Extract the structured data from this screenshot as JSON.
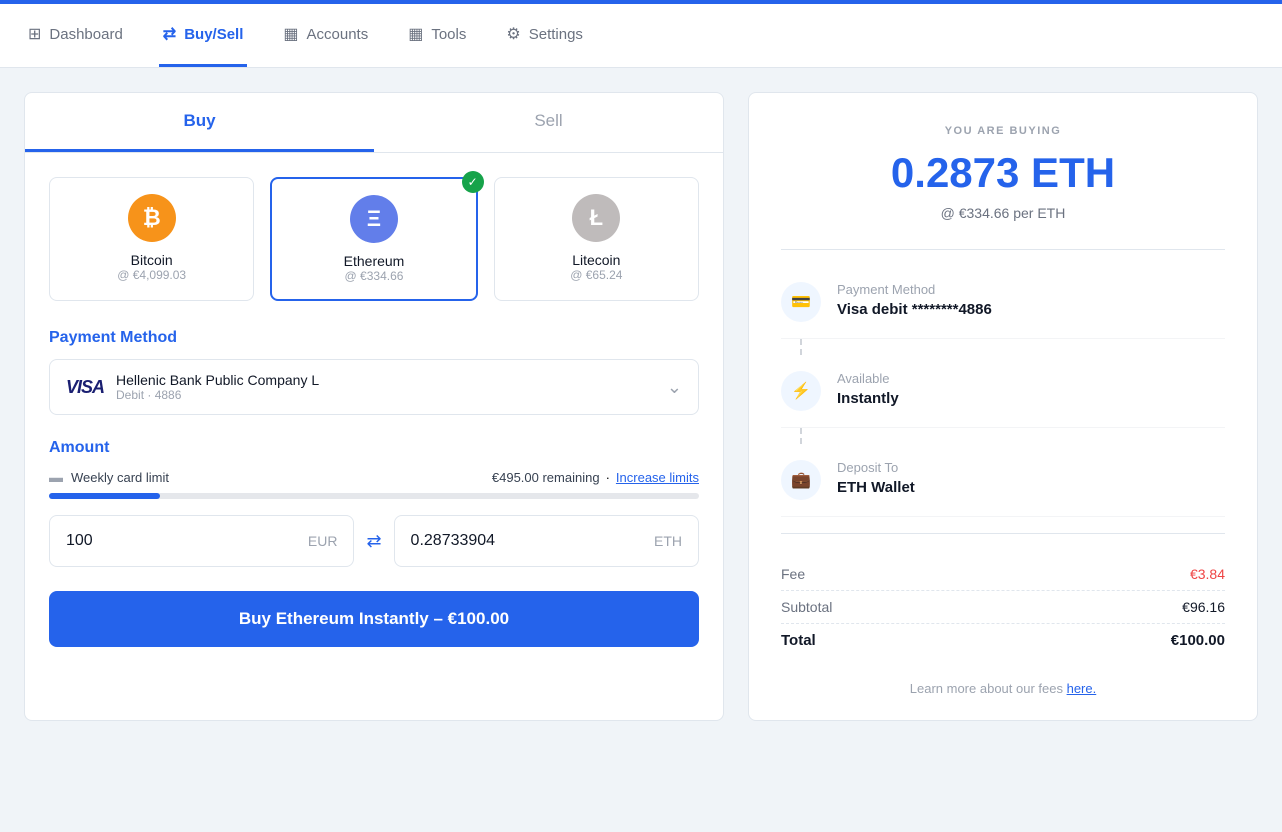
{
  "nav": {
    "items": [
      {
        "id": "dashboard",
        "label": "Dashboard",
        "icon": "⊞",
        "active": false
      },
      {
        "id": "buysell",
        "label": "Buy/Sell",
        "icon": "⇄",
        "active": true
      },
      {
        "id": "accounts",
        "label": "Accounts",
        "icon": "▦",
        "active": false
      },
      {
        "id": "tools",
        "label": "Tools",
        "icon": "▦",
        "active": false
      },
      {
        "id": "settings",
        "label": "Settings",
        "icon": "⚙",
        "active": false
      }
    ]
  },
  "tabs": {
    "buy_label": "Buy",
    "sell_label": "Sell"
  },
  "cryptos": [
    {
      "id": "bitcoin",
      "name": "Bitcoin",
      "price": "@ €4,099.03",
      "symbol": "₿",
      "color": "bitcoin",
      "selected": false
    },
    {
      "id": "ethereum",
      "name": "Ethereum",
      "price": "@ €334.66",
      "symbol": "Ξ",
      "color": "ethereum",
      "selected": true
    },
    {
      "id": "litecoin",
      "name": "Litecoin",
      "price": "@ €65.24",
      "symbol": "Ł",
      "color": "litecoin",
      "selected": false
    }
  ],
  "payment": {
    "section_label": "Payment Method",
    "bank_name": "Hellenic Bank Public Company L",
    "card_type": "Debit · 4886",
    "visa_label": "VISA"
  },
  "amount": {
    "section_label": "Amount",
    "weekly_limit_label": "Weekly card limit",
    "remaining": "€495.00 remaining",
    "increase_label": "Increase limits",
    "progress_percent": 17,
    "eur_value": "100",
    "eur_currency": "EUR",
    "eth_value": "0.28733904",
    "eth_currency": "ETH"
  },
  "buy_button": {
    "label": "Buy Ethereum Instantly – €100.00"
  },
  "summary": {
    "you_are_buying": "YOU ARE BUYING",
    "amount": "0.2873 ETH",
    "rate": "@ €334.66 per ETH",
    "payment_method_label": "Payment Method",
    "payment_method_value": "Visa debit ********4886",
    "available_label": "Available",
    "available_value": "Instantly",
    "deposit_label": "Deposit To",
    "deposit_value": "ETH Wallet",
    "fee_label": "Fee",
    "fee_value": "€3.84",
    "subtotal_label": "Subtotal",
    "subtotal_value": "€96.16",
    "total_label": "Total",
    "total_value": "€100.00",
    "footer_text": "Learn more about our fees ",
    "footer_link": "here."
  }
}
